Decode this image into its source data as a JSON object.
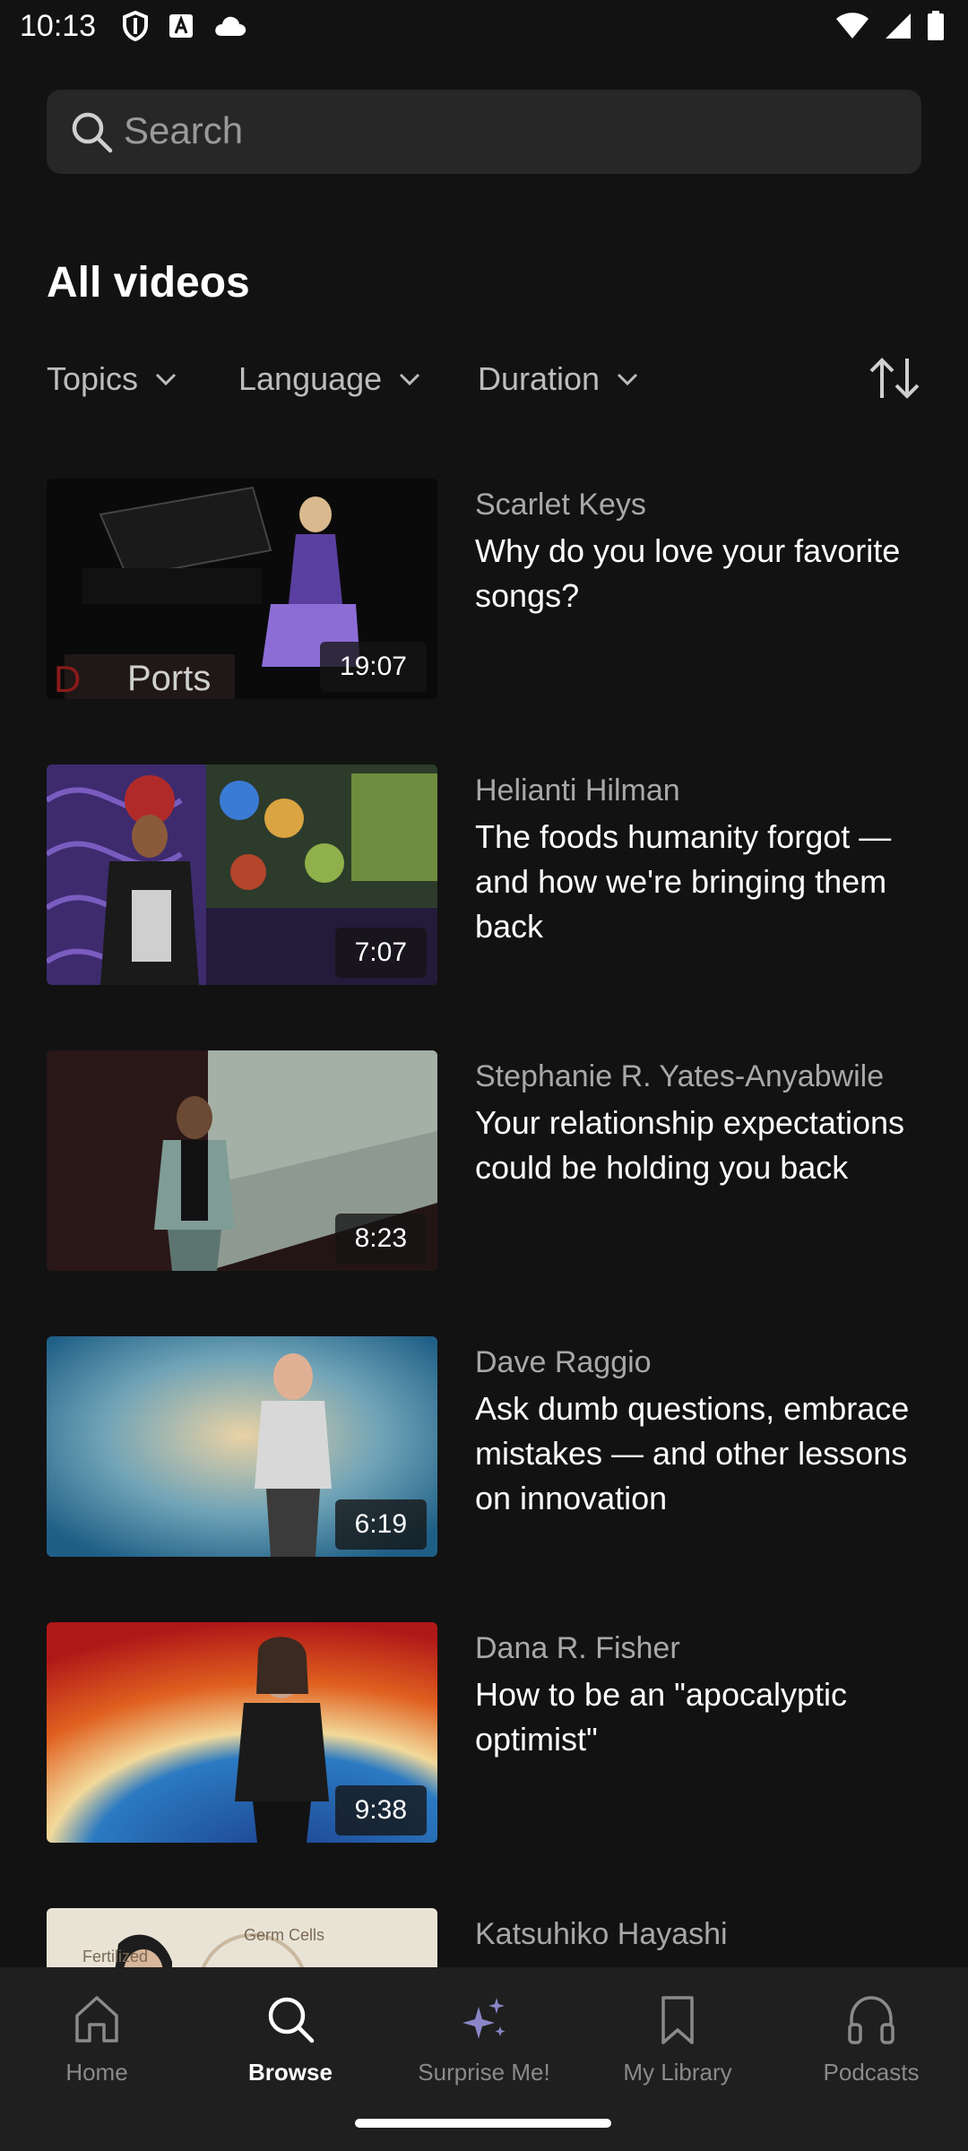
{
  "status_bar": {
    "time": "10:13",
    "left_icons": [
      "shield-icon",
      "a-badge-icon",
      "cloud-icon"
    ],
    "right_icons": [
      "wifi-icon",
      "signal-icon",
      "battery-icon"
    ]
  },
  "search": {
    "placeholder": "Search",
    "icon": "search-icon"
  },
  "section_title": "All videos",
  "filters": [
    {
      "label": "Topics"
    },
    {
      "label": "Language"
    },
    {
      "label": "Duration"
    }
  ],
  "sort_icon": "sort-arrows-icon",
  "videos": [
    {
      "speaker": "Scarlet Keys",
      "title": "Why do you love your favorite songs?",
      "duration": "19:07",
      "thumb_text": "Ports"
    },
    {
      "speaker": "Helianti Hilman",
      "title": "The foods humanity forgot — and how we're bringing them back",
      "duration": "7:07"
    },
    {
      "speaker": "Stephanie R. Yates-Anyabwile",
      "title": "Your relationship expectations could be holding you back",
      "duration": "8:23"
    },
    {
      "speaker": "Dave Raggio",
      "title": "Ask dumb questions, embrace mistakes — and other lessons on innovation",
      "duration": "6:19"
    },
    {
      "speaker": "Dana R. Fisher",
      "title": "How to be an \"apocalyptic optimist\"",
      "duration": "9:38"
    },
    {
      "speaker": "Katsuhiko Hayashi",
      "title": "",
      "duration": "",
      "thumb_text_1": "Fertilized",
      "thumb_text_2": "Germ Cells"
    }
  ],
  "nav": [
    {
      "label": "Home",
      "icon": "home-icon",
      "active": false
    },
    {
      "label": "Browse",
      "icon": "search-icon",
      "active": true
    },
    {
      "label": "Surprise Me!",
      "icon": "sparkle-icon",
      "active": false
    },
    {
      "label": "My Library",
      "icon": "bookmark-icon",
      "active": false
    },
    {
      "label": "Podcasts",
      "icon": "headphones-icon",
      "active": false
    }
  ],
  "colors": {
    "background": "#121212",
    "surface": "#272727",
    "nav_background": "#1f1f1f",
    "secondary_text": "#a8a8a8",
    "inactive_nav": "#8a8a8a"
  }
}
